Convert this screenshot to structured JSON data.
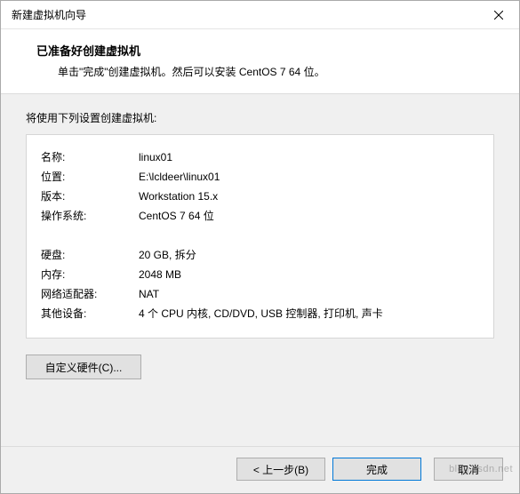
{
  "titlebar": {
    "title": "新建虚拟机向导"
  },
  "header": {
    "heading": "已准备好创建虚拟机",
    "subtext": "单击\"完成\"创建虚拟机。然后可以安装 CentOS 7 64 位。"
  },
  "body": {
    "caption": "将使用下列设置创建虚拟机:",
    "rows": [
      {
        "label": "名称:",
        "value": "linux01"
      },
      {
        "label": "位置:",
        "value": "E:\\lcldeer\\linux01"
      },
      {
        "label": "版本:",
        "value": "Workstation 15.x"
      },
      {
        "label": "操作系统:",
        "value": "CentOS 7 64 位"
      }
    ],
    "rows2": [
      {
        "label": "硬盘:",
        "value": "20 GB, 拆分"
      },
      {
        "label": "内存:",
        "value": "2048 MB"
      },
      {
        "label": "网络适配器:",
        "value": "NAT"
      },
      {
        "label": "其他设备:",
        "value": "4 个 CPU 内核, CD/DVD, USB 控制器, 打印机, 声卡"
      }
    ],
    "customize_label": "自定义硬件(C)..."
  },
  "footer": {
    "back": "< 上一步(B)",
    "finish": "完成",
    "cancel": "取消"
  },
  "watermark": "blog.csdn.net"
}
